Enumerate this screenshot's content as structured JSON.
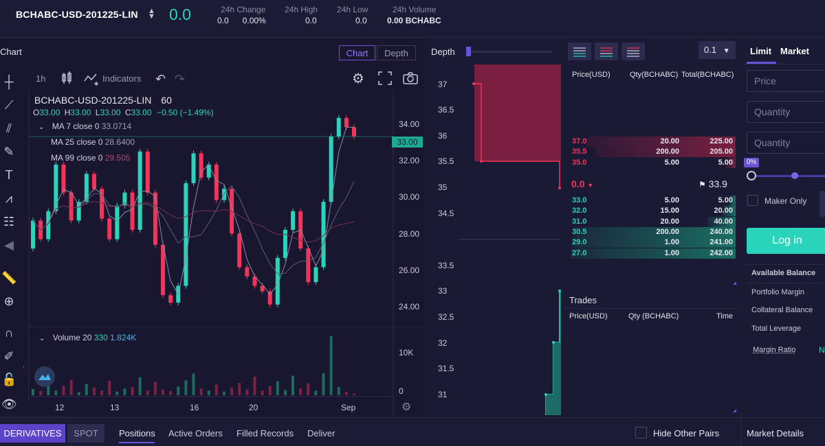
{
  "header": {
    "pair": "BCHABC-USD-201225-LIN",
    "last_price": "0.0",
    "stats": [
      {
        "label": "24h Change",
        "value": "0.0      0.00%"
      },
      {
        "label": "24h High",
        "value": "0.0"
      },
      {
        "label": "24h Low",
        "value": "0.0"
      },
      {
        "label": "24h Volume",
        "value": "0.00 BCHABC"
      }
    ]
  },
  "chart": {
    "panel_title": "Chart",
    "tab_chart": "Chart",
    "tab_depth": "Depth",
    "interval": "1h",
    "indicators": "Indicators",
    "legend_symbol": "BCHABC-USD-201225-LIN",
    "legend_interval": "60",
    "ohlc": {
      "o_label": "O",
      "o": "33.00",
      "h_label": "H",
      "h": "33.00",
      "l_label": "L",
      "l": "33.00",
      "c_label": "C",
      "c": "33.00",
      "change": "−0.50 (−1.49%)"
    },
    "ma": [
      {
        "label": "MA 7 close 0",
        "value": "33.0714",
        "color": "#c9cbd8"
      },
      {
        "label": "MA 25 close 0",
        "value": "28.6400",
        "color": "#c9cbd8"
      },
      {
        "label": "MA 99 close 0",
        "value": "29.505",
        "color": "#b04a74"
      }
    ],
    "volume_label": "Volume 20",
    "volume_a": "330",
    "volume_b": "1.824K",
    "price_ticks": [
      "34.00",
      "32.00",
      "30.00",
      "28.00",
      "26.00",
      "24.00"
    ],
    "price_tag": "33.00",
    "volume_ticks": [
      "10K",
      "0"
    ],
    "x_ticks": [
      "12",
      "13",
      "16",
      "20",
      "Sep"
    ]
  },
  "chart_data": {
    "type": "candlestick",
    "y_unit": "USD",
    "ylim": [
      23.0,
      35.5
    ],
    "candles": [
      {
        "o": 27.0,
        "c": 28.5
      },
      {
        "o": 28.5,
        "c": 27.5
      },
      {
        "o": 27.5,
        "c": 29.0
      },
      {
        "o": 29.0,
        "c": 31.5
      },
      {
        "o": 31.5,
        "c": 30.0
      },
      {
        "o": 30.0,
        "c": 28.5
      },
      {
        "o": 28.5,
        "c": 29.5
      },
      {
        "o": 29.5,
        "c": 31.0
      },
      {
        "o": 31.0,
        "c": 30.2
      },
      {
        "o": 30.2,
        "c": 28.6
      },
      {
        "o": 28.6,
        "c": 27.5
      },
      {
        "o": 27.5,
        "c": 29.3
      },
      {
        "o": 29.3,
        "c": 30.0
      },
      {
        "o": 30.0,
        "c": 28.0
      },
      {
        "o": 28.0,
        "c": 32.2
      },
      {
        "o": 32.2,
        "c": 30.0
      },
      {
        "o": 30.0,
        "c": 27.2
      },
      {
        "o": 27.2,
        "c": 24.5
      },
      {
        "o": 24.5,
        "c": 24.1
      },
      {
        "o": 24.1,
        "c": 25.0
      },
      {
        "o": 25.0,
        "c": 30.5
      },
      {
        "o": 30.5,
        "c": 32.1
      },
      {
        "o": 32.1,
        "c": 30.8
      },
      {
        "o": 30.8,
        "c": 31.5
      },
      {
        "o": 31.5,
        "c": 29.6
      },
      {
        "o": 29.6,
        "c": 30.2
      },
      {
        "o": 30.2,
        "c": 27.8
      },
      {
        "o": 27.8,
        "c": 26.0
      },
      {
        "o": 26.0,
        "c": 25.5
      },
      {
        "o": 25.5,
        "c": 25.0
      },
      {
        "o": 25.0,
        "c": 24.7
      },
      {
        "o": 24.7,
        "c": 24.0
      },
      {
        "o": 24.0,
        "c": 26.5
      },
      {
        "o": 26.5,
        "c": 28.0
      },
      {
        "o": 28.0,
        "c": 29.0
      },
      {
        "o": 29.0,
        "c": 27.0
      },
      {
        "o": 27.0,
        "c": 25.2
      },
      {
        "o": 25.2,
        "c": 26.0
      },
      {
        "o": 26.0,
        "c": 29.5
      },
      {
        "o": 29.5,
        "c": 33.0
      },
      {
        "o": 33.0,
        "c": 34.0
      },
      {
        "o": 34.0,
        "c": 33.5
      },
      {
        "o": 33.5,
        "c": 33.0
      }
    ],
    "volume_max": 12000,
    "volumes": [
      1200,
      800,
      2500,
      900,
      1800,
      3000,
      600,
      2200,
      1500,
      900,
      2800,
      700,
      1300,
      1600,
      3500,
      900,
      2600,
      1100,
      800,
      1700,
      2900,
      4200,
      1300,
      900,
      2100,
      700,
      1500,
      2400,
      1100,
      3600,
      900,
      1800,
      2700,
      1000,
      3800,
      1300,
      2300,
      900,
      4300,
      11500,
      1600,
      700,
      300
    ]
  },
  "depth": {
    "title": "Depth",
    "y_ticks": [
      "37",
      "36.5",
      "36",
      "35.5",
      "35",
      "34.5",
      "33.5",
      "33",
      "32.5",
      "32",
      "31.5",
      "31"
    ]
  },
  "orderbook": {
    "step": "0.1",
    "col_price": "Price(USD)",
    "col_qty": "Qty(BCHABC)",
    "col_total": "Total(BCHABC)",
    "asks": [
      {
        "price": "37.0",
        "qty": "20.00",
        "total": "225.00",
        "depth": 0.9
      },
      {
        "price": "35.5",
        "qty": "200.00",
        "total": "205.00",
        "depth": 0.85
      },
      {
        "price": "35.0",
        "qty": "5.00",
        "total": "5.00",
        "depth": 0.06
      }
    ],
    "mid_price": "0.0",
    "mark_price": "33.9",
    "bids": [
      {
        "price": "33.0",
        "qty": "5.00",
        "total": "5.00",
        "depth": 0.04
      },
      {
        "price": "32.0",
        "qty": "15.00",
        "total": "20.00",
        "depth": 0.08
      },
      {
        "price": "31.0",
        "qty": "20.00",
        "total": "40.00",
        "depth": 0.17
      },
      {
        "price": "30.5",
        "qty": "200.00",
        "total": "240.00",
        "depth": 0.98
      },
      {
        "price": "29.0",
        "qty": "1.00",
        "total": "241.00",
        "depth": 0.99
      },
      {
        "price": "27.0",
        "qty": "1.00",
        "total": "242.00",
        "depth": 1.0
      }
    ]
  },
  "trades": {
    "title": "Trades",
    "col_price": "Price(USD)",
    "col_qty": "Qty (BCHABC)",
    "col_time": "Time"
  },
  "order_form": {
    "tab_limit": "Limit",
    "tab_market": "Market",
    "price_placeholder": "Price",
    "quantity_placeholder": "Quantity",
    "quantity2_placeholder": "Quantity",
    "slider_pct": "0%",
    "maker_only": "Maker Only",
    "login": "Log in",
    "available_balance": "Available Balance",
    "portfolio_margin": "Portfolio Margin",
    "collateral_balance": "Collateral Balance",
    "total_leverage": "Total Leverage",
    "margin_ratio": "Margin Ratio",
    "margin_ratio_value": "N"
  },
  "bottom": {
    "derivatives": "DERIVATIVES",
    "spot": "SPOT",
    "tabs": [
      "Positions",
      "Active Orders",
      "Filled Records",
      "Deliver"
    ],
    "hide_other_pairs": "Hide Other Pairs",
    "market_details": "Market Details"
  },
  "colors": {
    "up": "#2ad4bb",
    "down": "#f0345a",
    "accent": "#6a52d9"
  }
}
